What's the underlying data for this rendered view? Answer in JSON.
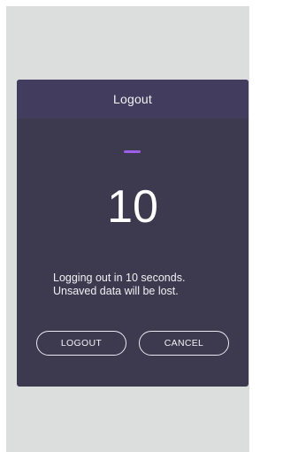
{
  "dialog": {
    "title": "Logout",
    "countdown": "10",
    "message_line1": "Logging out in 10 seconds.",
    "message_line2": "Unsaved data will be lost.",
    "logout_label": "LOGOUT",
    "cancel_label": "CANCEL"
  },
  "colors": {
    "screen_background": "#dcdedd",
    "dialog_background": "#3d3a4f",
    "header_background": "#423c5e",
    "accent": "#9b5fe8"
  }
}
